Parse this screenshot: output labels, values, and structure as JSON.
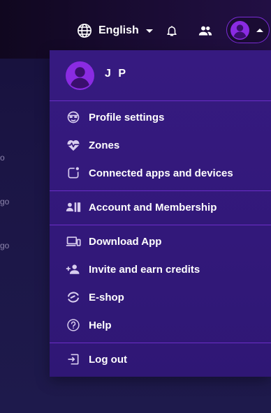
{
  "header": {
    "language_label": "English",
    "language_icon": "globe-icon",
    "notification_icon": "bell-icon",
    "community_icon": "people-icon",
    "avatar_icon": "user-avatar-icon"
  },
  "background": {
    "fragments": [
      "o",
      "go",
      "go"
    ]
  },
  "menu": {
    "user_name": "J P",
    "sections": [
      {
        "items": [
          {
            "label": "Profile settings",
            "icon": "profile-mask-icon"
          },
          {
            "label": "Zones",
            "icon": "heart-pulse-icon"
          },
          {
            "label": "Connected apps and devices",
            "icon": "connected-device-icon"
          }
        ]
      },
      {
        "items": [
          {
            "label": "Account and Membership",
            "icon": "membership-card-icon"
          }
        ]
      },
      {
        "items": [
          {
            "label": "Download App",
            "icon": "devices-icon"
          },
          {
            "label": "Invite and earn credits",
            "icon": "add-person-icon"
          },
          {
            "label": "E-shop",
            "icon": "eshop-logo-icon"
          },
          {
            "label": "Help",
            "icon": "help-circle-icon"
          }
        ]
      },
      {
        "items": [
          {
            "label": "Log out",
            "icon": "logout-icon"
          }
        ]
      }
    ]
  },
  "colors": {
    "menu_bg": "#31167a",
    "accent": "#8a2be2",
    "divider": "#6c2ec9",
    "icon": "#d8cdef",
    "topbar": "#14091f"
  }
}
